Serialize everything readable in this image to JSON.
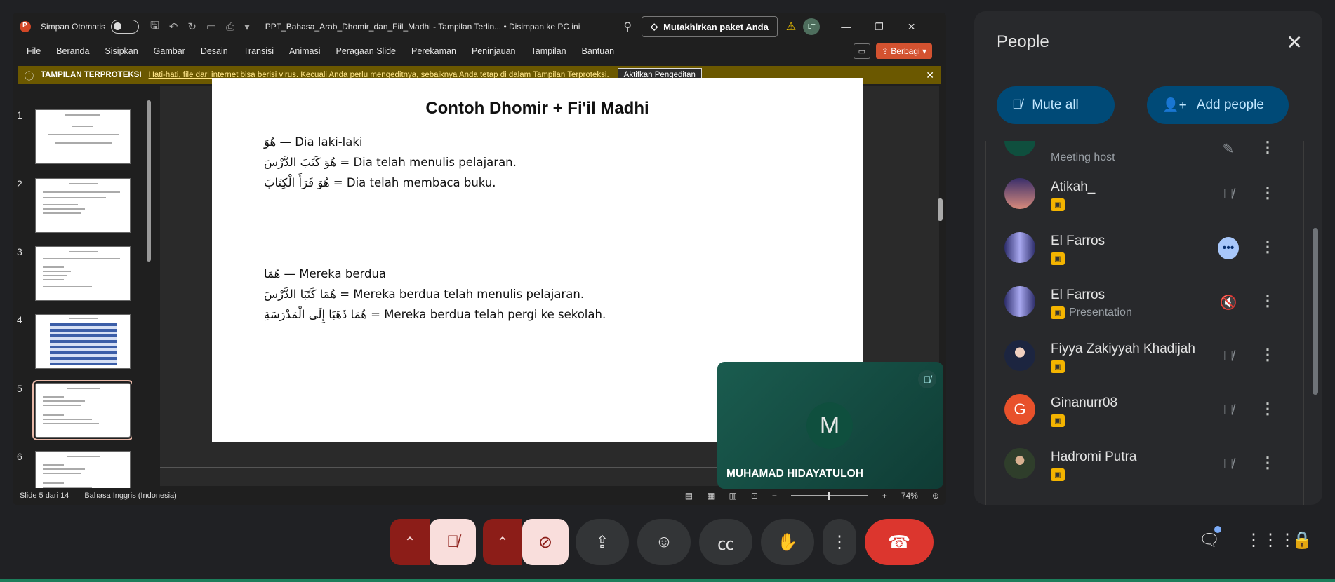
{
  "ppt": {
    "autosave_label": "Simpan Otomatis",
    "doc_title": "PPT_Bahasa_Arab_Dhomir_dan_Fiil_Madhi  -  Tampilan Terlin...  • Disimpan ke PC ini",
    "upgrade_label": "Mutakhirkan paket Anda",
    "user_initials": "LT",
    "menu": [
      "File",
      "Beranda",
      "Sisipkan",
      "Gambar",
      "Desain",
      "Transisi",
      "Animasi",
      "Peragaan Slide",
      "Perekaman",
      "Peninjauan",
      "Tampilan",
      "Bantuan"
    ],
    "share_label": "Berbagi",
    "protected": {
      "title": "TAMPILAN TERPROTEKSI",
      "message": "Hati-hati, file dari internet bisa berisi virus. Kecuali Anda perlu mengeditnya, sebaiknya Anda tetap di dalam Tampilan Terproteksi.",
      "button": "Aktifkan Pengeditan"
    },
    "thumbnails": [
      "1",
      "2",
      "3",
      "4",
      "5",
      "6"
    ],
    "slide": {
      "title": "Contoh Dhomir + Fi'il Madhi",
      "lines": [
        "هُوَ — Dia laki-laki",
        "هُوَ كَتَبَ الدَّرْسَ = Dia telah menulis pelajaran.",
        "هُوَ قَرَأَ الْكِتَابَ = Dia telah membaca buku.",
        "هُمَا — Mereka berdua",
        "هُمَا كَتَبَا الدَّرْسَ = Mereka berdua telah menulis pelajaran.",
        "هُمَا ذَهَبَا إِلَى الْمَدْرَسَةِ = Mereka berdua telah pergi ke sekolah."
      ]
    },
    "status": {
      "slide_pos": "Slide 5 dari 14",
      "language": "Bahasa Inggris (Indonesia)",
      "zoom": "74%"
    }
  },
  "tile": {
    "initial": "M",
    "name": "MUHAMAD HIDAYATULOH"
  },
  "people": {
    "title": "People",
    "mute_all": "Mute all",
    "add_people": "Add people",
    "host_label": "Meeting host",
    "participants": [
      {
        "name": "Atikah_",
        "sub": ""
      },
      {
        "name": "El Farros",
        "sub": ""
      },
      {
        "name": "El Farros",
        "sub": "Presentation"
      },
      {
        "name": "Fiyya Zakiyyah Khadijah",
        "sub": ""
      },
      {
        "name": "Ginanurr08",
        "sub": "",
        "initial": "G"
      },
      {
        "name": "Hadromi Putra",
        "sub": ""
      }
    ]
  },
  "colors": {
    "hangup": "#dc362e",
    "muted_bg": "#f9dedc",
    "accent_button": "#004a77",
    "presentation_badge": "#f4b400"
  }
}
